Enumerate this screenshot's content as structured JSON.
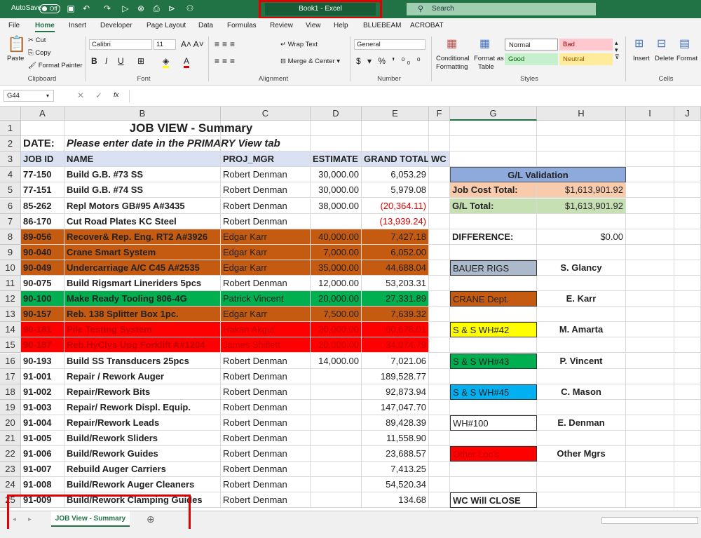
{
  "titlebar": {
    "autosave": "AutoSave",
    "toggle": "Off",
    "doc_title": "Book1  -  Excel",
    "search": "Search"
  },
  "menu": [
    "File",
    "Home",
    "Insert",
    "Developer",
    "Page Layout",
    "Data",
    "Formulas",
    "Review",
    "View",
    "Help",
    "BLUEBEAM",
    "ACROBAT"
  ],
  "ribbon": {
    "paste": "Paste",
    "cut": "Cut",
    "copy": "Copy",
    "format_painter": "Format Painter",
    "clipboard": "Clipboard",
    "font_name": "Calibri",
    "font_size": "11",
    "font_group": "Font",
    "wrap_text": "Wrap Text",
    "merge_center": "Merge & Center",
    "alignment": "Alignment",
    "number_format": "General",
    "number_group": "Number",
    "cond_fmt_1": "Conditional",
    "cond_fmt_2": "Formatting",
    "fmt_table_1": "Format as",
    "fmt_table_2": "Table",
    "style_normal": "Normal",
    "style_bad": "Bad",
    "style_good": "Good",
    "style_neutral": "Neutral",
    "styles": "Styles",
    "insert": "Insert",
    "delete": "Delete",
    "format": "Format",
    "cells": "Cells"
  },
  "formulabar": {
    "namebox": "G44",
    "fx": "fx"
  },
  "colors": {
    "green": "#217346",
    "orange": "#c55a11",
    "bright_green": "#00b050",
    "red": "#ff0000",
    "yellow": "#ffff00",
    "blue": "#00b0f0",
    "gray": "#acb9ca",
    "header_fill": "#d9e1f2",
    "validation_fill": "#8ea9db",
    "peach": "#f8cbad",
    "light_green": "#c6e0b4"
  },
  "columns": [
    "A",
    "B",
    "C",
    "D",
    "E",
    "F",
    "G",
    "H",
    "I",
    "J"
  ],
  "rows": [
    "1",
    "2",
    "3",
    "4",
    "5",
    "6",
    "7",
    "8",
    "9",
    "10",
    "11",
    "12",
    "13",
    "14",
    "15",
    "16",
    "17",
    "18",
    "19",
    "20",
    "21",
    "22",
    "23",
    "24",
    "25"
  ],
  "sheet": {
    "title": "JOB VIEW - Summary",
    "date_label": "DATE:",
    "date_note": "Please enter date in the PRIMARY View tab",
    "headers": [
      "JOB ID",
      "NAME",
      "PROJ_MGR",
      "ESTIMATE",
      "GRAND TOTAL",
      "WC"
    ],
    "jobs": [
      {
        "id": "77-150",
        "name": "Build G.B. #73 SS",
        "mgr": "Robert Denman",
        "est": "30,000.00",
        "total": "6,053.29"
      },
      {
        "id": "77-151",
        "name": "Build G.B. #74 SS",
        "mgr": "Robert Denman",
        "est": "30,000.00",
        "total": "5,979.08"
      },
      {
        "id": "85-262",
        "name": "Repl Motors GB#95 A#3435",
        "mgr": "Robert Denman",
        "est": "38,000.00",
        "total": "(20,364.11)"
      },
      {
        "id": "86-170",
        "name": "Cut Road Plates KC Steel",
        "mgr": "Robert Denman",
        "est": "",
        "total": "(13,939.24)"
      },
      {
        "id": "89-056",
        "name": "Recover& Rep. Eng. RT2 A#3926",
        "mgr": "Edgar Karr",
        "est": "40,000.00",
        "total": "7,427.18"
      },
      {
        "id": "90-040",
        "name": "Crane Smart System",
        "mgr": "Edgar Karr",
        "est": "7,000.00",
        "total": "6,052.00"
      },
      {
        "id": "90-049",
        "name": " Undercarriage A/C C45 A#2535",
        "mgr": "Edgar Karr",
        "est": "35,000.00",
        "total": "44,688.04"
      },
      {
        "id": "90-075",
        "name": "Build Rigsmart Lineriders 5pcs",
        "mgr": "Robert Denman",
        "est": "12,000.00",
        "total": "53,203.31"
      },
      {
        "id": "90-100",
        "name": "Make Ready Tooling 806-4G",
        "mgr": "Patrick Vincent",
        "est": "20,000.00",
        "total": "27,331.89"
      },
      {
        "id": "90-157",
        "name": "Reb. 138 Splitter Box 1pc.",
        "mgr": "Edgar Karr",
        "est": "7,500.00",
        "total": "7,639.32"
      },
      {
        "id": "90-181",
        "name": "Pile Testing System",
        "mgr": "Hakan Akgul",
        "est": "20,000.00",
        "total": "60,678.01"
      },
      {
        "id": "90-187",
        "name": "Reb.HyClys Upg Forklift A#1204",
        "mgr": "James Shiflett",
        "est": "20,000.00",
        "total": "34,074.79"
      },
      {
        "id": "90-193",
        "name": "Build  SS Transducers 25pcs",
        "mgr": "Robert Denman",
        "est": "14,000.00",
        "total": "7,021.06"
      },
      {
        "id": "91-001",
        "name": "Repair / Rework Auger",
        "mgr": "Robert Denman",
        "est": "",
        "total": "189,528.77"
      },
      {
        "id": "91-002",
        "name": "Repair/Rework Bits",
        "mgr": "Robert Denman",
        "est": "",
        "total": "92,873.94"
      },
      {
        "id": "91-003",
        "name": "Repair/ Rework Displ. Equip.",
        "mgr": "Robert Denman",
        "est": "",
        "total": "147,047.70"
      },
      {
        "id": "91-004",
        "name": "Repair/Rework Leads",
        "mgr": "Robert Denman",
        "est": "",
        "total": "89,428.39"
      },
      {
        "id": "91-005",
        "name": "Build/Rework Sliders",
        "mgr": "Robert Denman",
        "est": "",
        "total": "11,558.90"
      },
      {
        "id": "91-006",
        "name": "Build/Rework Guides",
        "mgr": "Robert Denman",
        "est": "",
        "total": "23,688.57"
      },
      {
        "id": "91-007",
        "name": "Rebuild Auger Carriers",
        "mgr": "Robert Denman",
        "est": "",
        "total": "7,413.25"
      },
      {
        "id": "91-008",
        "name": "Build/Rework Auger Cleaners",
        "mgr": "Robert Denman",
        "est": "",
        "total": "54,520.34"
      },
      {
        "id": "91-009",
        "name": "Build/Rework Clamping Guides",
        "mgr": "Robert Denman",
        "est": "",
        "total": "134.68"
      }
    ],
    "validation": {
      "title": "G/L Validation",
      "job_cost_label": "Job Cost Total:",
      "job_cost": "$1,613,901.92",
      "gl_label": "G/L Total:",
      "gl": "$1,613,901.92",
      "diff_label": "DIFFERENCE:",
      "diff": "$0.00"
    },
    "legend": [
      {
        "label": "BAUER RIGS",
        "mgr": "S. Glancy"
      },
      {
        "label": "CRANE Dept.",
        "mgr": "E. Karr"
      },
      {
        "label": "S & S WH#42",
        "mgr": "M. Amarta"
      },
      {
        "label": "S & S WH#43",
        "mgr": "P. Vincent"
      },
      {
        "label": "S & S WH#45",
        "mgr": "C. Mason"
      },
      {
        "label": "WH#100",
        "mgr": "E. Denman"
      },
      {
        "label": "Other Loc's",
        "mgr": "Other Mgrs"
      }
    ],
    "wc_note": "WC  Will CLOSE"
  },
  "tabs": {
    "sheet": "JOB View - Summary",
    "add": "⊕"
  }
}
